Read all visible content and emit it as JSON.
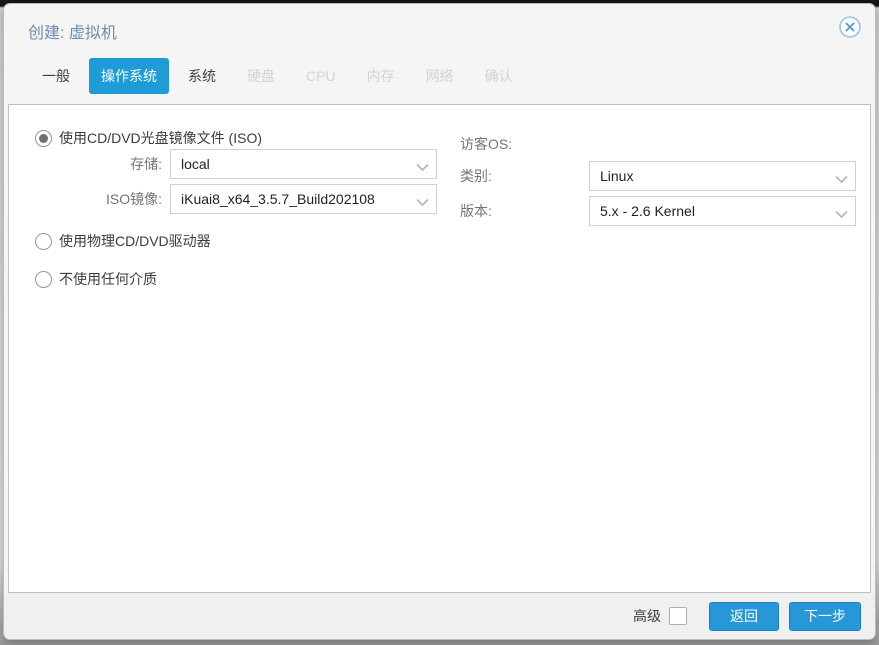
{
  "dialog": {
    "title": "创建: 虚拟机"
  },
  "tabs": [
    {
      "label": "一般",
      "state": "enabled"
    },
    {
      "label": "操作系统",
      "state": "active"
    },
    {
      "label": "系统",
      "state": "enabled"
    },
    {
      "label": "硬盘",
      "state": "disabled"
    },
    {
      "label": "CPU",
      "state": "disabled"
    },
    {
      "label": "内存",
      "state": "disabled"
    },
    {
      "label": "网络",
      "state": "disabled"
    },
    {
      "label": "确认",
      "state": "disabled"
    }
  ],
  "form": {
    "radio_iso": {
      "label": "使用CD/DVD光盘镜像文件 (ISO)",
      "selected": true
    },
    "radio_physical": {
      "label": "使用物理CD/DVD驱动器",
      "selected": false
    },
    "radio_none": {
      "label": "不使用任何介质",
      "selected": false
    },
    "storage": {
      "label": "存储:",
      "value": "local"
    },
    "iso_image": {
      "label": "ISO镜像:",
      "value": "iKuai8_x64_3.5.7_Build202108"
    },
    "guest_os": {
      "heading": "访客OS:",
      "type": {
        "label": "类别:",
        "value": "Linux"
      },
      "version": {
        "label": "版本:",
        "value": "5.x - 2.6 Kernel"
      }
    }
  },
  "footer": {
    "advanced_label": "高级",
    "advanced_checked": false,
    "back_button": "返回",
    "next_button": "下一步"
  },
  "icons": {
    "close": "circle-x-icon",
    "dropdown": "chevron-down-icon"
  },
  "colors": {
    "accent_blue": "#1d9cd8",
    "button_blue": "#2797d8",
    "title_blue": "#6c8cb3",
    "disabled_tab_gray": "#d3d3d3",
    "dialog_bg": "#f5f5f5",
    "panel_border": "#bfbfbf"
  }
}
